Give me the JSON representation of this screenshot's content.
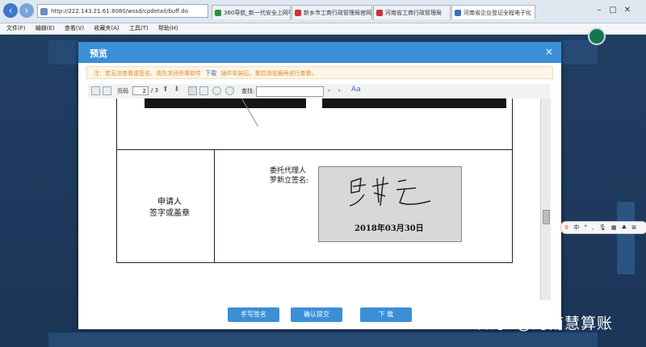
{
  "browser": {
    "address": "http://222.143.21.61:8080/wssd/cpdetail/buff.do",
    "tabs": [
      {
        "label": "360导航_新一代安全上网导航"
      },
      {
        "label": "新乡市工商行政管理局官网"
      },
      {
        "label": "河南省工商行政管理局"
      },
      {
        "label": "河南省企业登记全程电子化"
      }
    ],
    "menu": [
      "文件(F)",
      "编辑(E)",
      "查看(V)",
      "收藏夹(A)",
      "工具(T)",
      "帮助(H)"
    ],
    "notification_count": "1"
  },
  "modal": {
    "title": "预览",
    "close": "×",
    "notice_prefix": "注：若无法查看或签名，请先关闭杀毒软件",
    "notice_download": "下载",
    "notice_suffix": "插件安装后，重启浏览器再进行查看。",
    "toolbar": {
      "page_label": "页码",
      "page_current": "2",
      "page_total": "/ 3",
      "find_label": "查找:",
      "font_label": "Aa"
    },
    "document": {
      "applicant_line1": "申请人",
      "applicant_line2": "签字或盖章",
      "agent_line1": "委托代理人",
      "agent_line2": "罗新立签名:",
      "signature_name": "罗新立",
      "signature_date": "2018年03月30日"
    },
    "buttons": {
      "handwrite": "手写签名",
      "confirm": "确认提交",
      "download": "下 载"
    }
  },
  "ime": [
    "S",
    "中",
    "°",
    ",",
    "🎙",
    "▦",
    "♣",
    "⊞"
  ],
  "watermark": "知乎 @河南慧算账"
}
